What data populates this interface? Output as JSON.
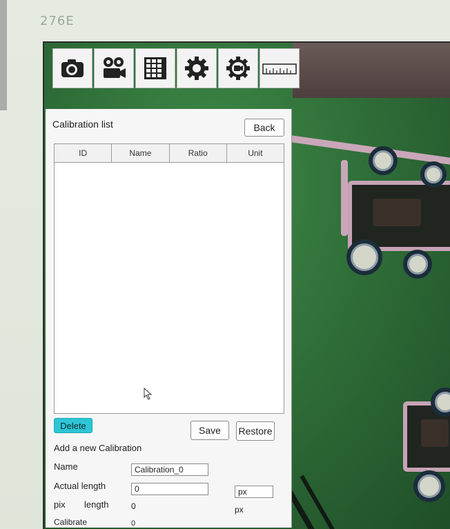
{
  "bezel": {
    "model": "276E"
  },
  "toolbar": {
    "tools": [
      {
        "icon": "camera-icon"
      },
      {
        "icon": "video-camera-icon"
      },
      {
        "icon": "grid-icon"
      },
      {
        "icon": "gear-icon"
      },
      {
        "icon": "camera-settings-icon"
      },
      {
        "icon": "ruler-icon"
      }
    ]
  },
  "panel": {
    "title": "Calibration list",
    "back_label": "Back",
    "table": {
      "columns": [
        "ID",
        "Name",
        "Ratio",
        "Unit"
      ],
      "rows": []
    },
    "delete_label": "Delete",
    "save_label": "Save",
    "restore_label": "Restore",
    "add_title": "Add a new Calibration",
    "name_label": "Name",
    "name_value": "Calibration_0",
    "actual_length_label": "Actual length",
    "actual_length_value": "0",
    "unit_value": "px",
    "pix_label": "pix",
    "length_label": "length",
    "pix_length_value": "0",
    "pix_unit": "px",
    "calibrate_label": "Calibrate",
    "calibrate_value": "0"
  },
  "colors": {
    "delete_accent": "#2dc6d6",
    "pcb_green": "#2f6e38"
  }
}
